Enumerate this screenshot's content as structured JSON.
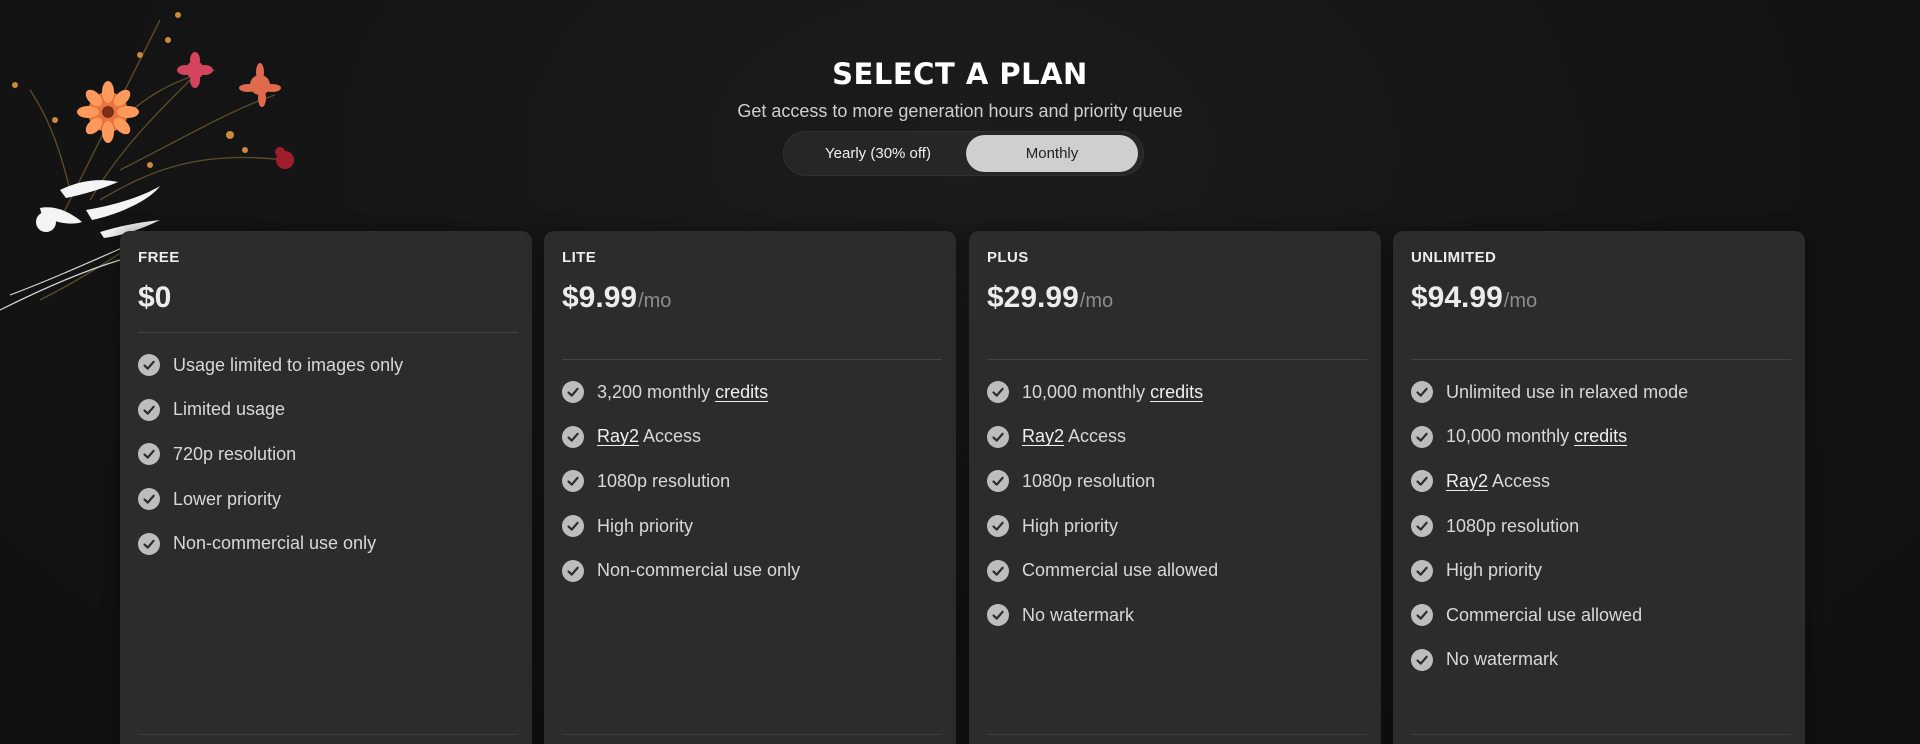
{
  "header": {
    "title": "SELECT A PLAN",
    "subtitle": "Get access to more generation hours and priority queue"
  },
  "billing_toggle": {
    "yearly_label": "Yearly (30% off)",
    "monthly_label": "Monthly",
    "selected": "Monthly"
  },
  "icons": {
    "feature_check": "check-circle-icon"
  },
  "colors": {
    "background": "#121212",
    "card": "#2c2c2c",
    "toggle_active": "#cfcfcf"
  },
  "plans": [
    {
      "name": "FREE",
      "price": "$0",
      "period": "",
      "features": [
        {
          "pre": "Usage limited to images only",
          "link": "",
          "post": ""
        },
        {
          "pre": "Limited usage",
          "link": "",
          "post": ""
        },
        {
          "pre": "720p resolution",
          "link": "",
          "post": ""
        },
        {
          "pre": "Lower priority",
          "link": "",
          "post": ""
        },
        {
          "pre": "Non-commercial use only",
          "link": "",
          "post": ""
        }
      ]
    },
    {
      "name": "LITE",
      "price": "$9.99",
      "period": "/mo",
      "features": [
        {
          "pre": "3,200 monthly ",
          "link": "credits",
          "post": ""
        },
        {
          "pre": "",
          "link": "Ray2",
          "post": " Access"
        },
        {
          "pre": "1080p resolution",
          "link": "",
          "post": ""
        },
        {
          "pre": "High priority",
          "link": "",
          "post": ""
        },
        {
          "pre": "Non-commercial use only",
          "link": "",
          "post": ""
        }
      ]
    },
    {
      "name": "PLUS",
      "price": "$29.99",
      "period": "/mo",
      "features": [
        {
          "pre": "10,000 monthly ",
          "link": "credits",
          "post": ""
        },
        {
          "pre": "",
          "link": "Ray2",
          "post": " Access"
        },
        {
          "pre": "1080p resolution",
          "link": "",
          "post": ""
        },
        {
          "pre": "High priority",
          "link": "",
          "post": ""
        },
        {
          "pre": "Commercial use allowed",
          "link": "",
          "post": ""
        },
        {
          "pre": "No watermark",
          "link": "",
          "post": ""
        }
      ]
    },
    {
      "name": "UNLIMITED",
      "price": "$94.99",
      "period": "/mo",
      "features": [
        {
          "pre": "Unlimited use in relaxed mode",
          "link": "",
          "post": ""
        },
        {
          "pre": "10,000 monthly ",
          "link": "credits",
          "post": ""
        },
        {
          "pre": "",
          "link": "Ray2",
          "post": " Access"
        },
        {
          "pre": "1080p resolution",
          "link": "",
          "post": ""
        },
        {
          "pre": "High priority",
          "link": "",
          "post": ""
        },
        {
          "pre": "Commercial use allowed",
          "link": "",
          "post": ""
        },
        {
          "pre": "No watermark",
          "link": "",
          "post": ""
        }
      ]
    }
  ]
}
